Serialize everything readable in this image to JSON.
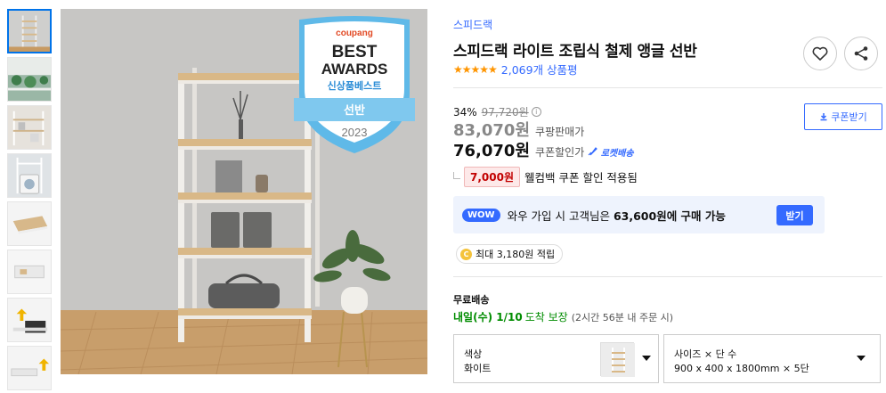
{
  "product": {
    "brand": "스피드랙",
    "title": "스피드랙 라이트 조립식 철제 앵글 선반",
    "stars": "★★★★★",
    "review_count": "2,069개 상품평",
    "rating_fraction": 1.0
  },
  "price": {
    "discount_percent": "34%",
    "original": "97,720원",
    "info_glyph": "i",
    "sale_price": "83,070원",
    "sale_label": "쿠팡판매가",
    "coupon_price": "76,070원",
    "coupon_label": "쿠폰할인가",
    "rocket_label": "로켓배송",
    "coupon_button": "쿠폰받기"
  },
  "cashback": {
    "amount": "7,000원",
    "text": "웰컴백 쿠폰 할인 적용됨"
  },
  "wow": {
    "badge": "WOW",
    "text_prefix": "와우 가입 시 고객님은 ",
    "text_bold": "63,600원에 구매 가능",
    "button": "받기"
  },
  "points": {
    "coin": "C",
    "text": "최대 3,180원 적립"
  },
  "shipping": {
    "title": "무료배송",
    "date": "내일(수) 1/10",
    "arrive": "도착 보장",
    "note": "(2시간 56분 내 주문 시)"
  },
  "options": {
    "color_label": "색상",
    "color_value": "화이트",
    "size_label": "사이즈 × 단 수",
    "size_value": "900 x 400 x 1800mm × 5단"
  },
  "award_badge": {
    "brand": "coupang",
    "line1": "BEST",
    "line2": "AWARDS",
    "line3": "신상품베스트",
    "category": "선반",
    "year": "2023"
  },
  "colors": {
    "accent": "#346aff",
    "star": "#ff9500",
    "green": "#008c00",
    "red": "#c20000"
  }
}
